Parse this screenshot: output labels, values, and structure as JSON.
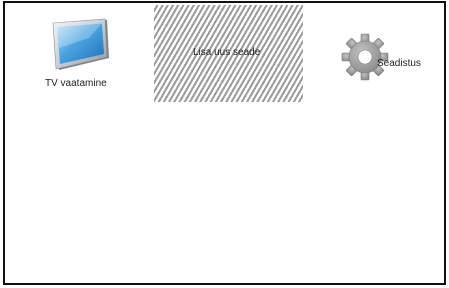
{
  "menu": {
    "items": [
      {
        "label": "TV vaatamine",
        "icon": "tv-icon",
        "selected": false
      },
      {
        "label": "Lisa uus seade",
        "icon": "",
        "selected": true
      },
      {
        "label": "Seadistus",
        "icon": "gear-icon",
        "selected": false
      }
    ]
  },
  "colors": {
    "selection_stripe": "#9a9a9a",
    "tv_screen": "#4aa3e0",
    "gear": "#9b9b9b",
    "frame": "#111111"
  }
}
